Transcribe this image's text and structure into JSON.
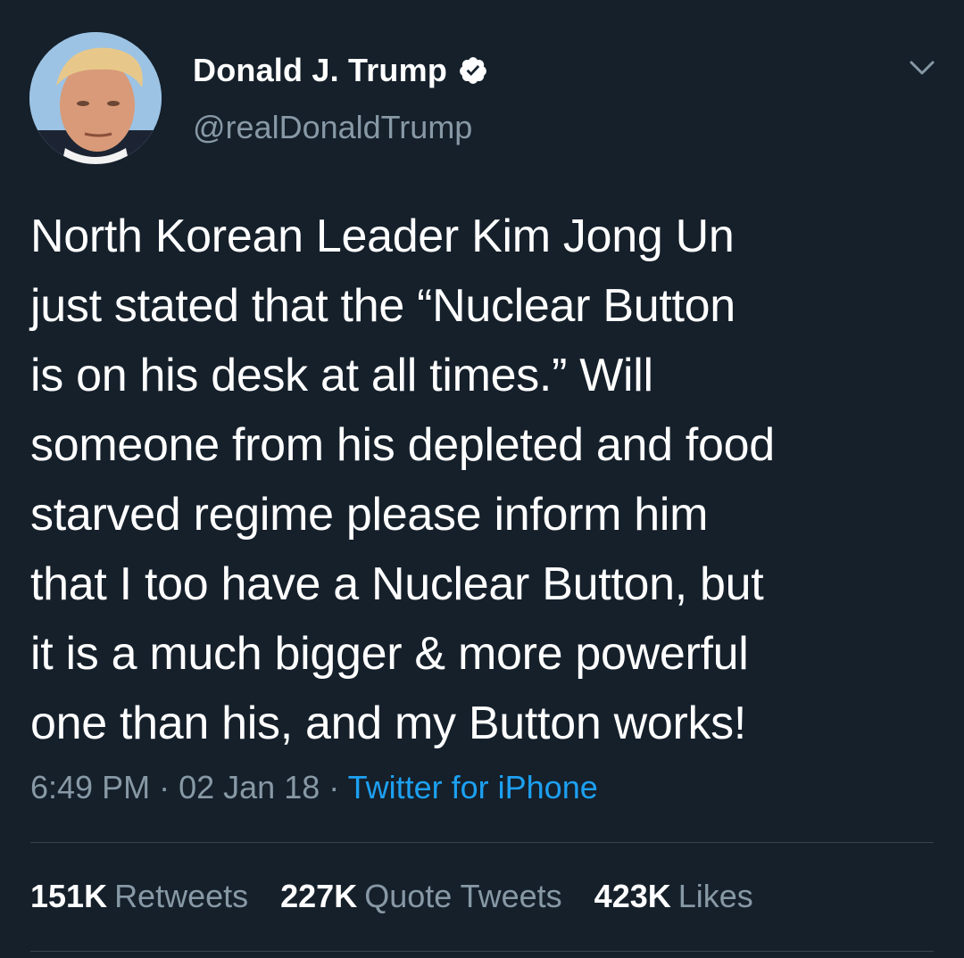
{
  "author": {
    "display_name": "Donald J. Trump",
    "handle": "@realDonaldTrump",
    "verified_icon": "verified-badge-icon"
  },
  "menu_icon": "chevron-down-icon",
  "tweet": {
    "lines": [
      "North Korean Leader Kim Jong Un",
      "just stated that the “Nuclear Button",
      "is on his desk at all times.” Will",
      "someone from his depleted and food",
      "starved regime please inform him",
      "that I too have a Nuclear Button, but",
      "it is a much bigger & more powerful",
      "one than his, and my Button works!"
    ],
    "time": "6:49 PM",
    "separator": "·",
    "date": "02 Jan 18",
    "source": "Twitter for iPhone"
  },
  "stats": {
    "retweets": {
      "count": "151K",
      "label": "Retweets"
    },
    "quote_tweets": {
      "count": "227K",
      "label": "Quote Tweets"
    },
    "likes": {
      "count": "423K",
      "label": "Likes"
    }
  },
  "colors": {
    "background": "#15202b",
    "primary_text": "#ffffff",
    "secondary_text": "#8899a6",
    "accent": "#1da1f2",
    "divider": "#38444d"
  }
}
